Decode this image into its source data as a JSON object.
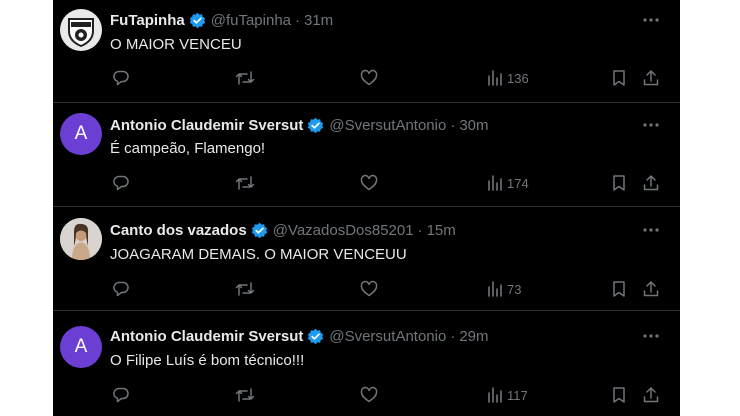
{
  "tweets": [
    {
      "name": "FuTapinha",
      "handle": "@fuTapinha",
      "time": "31m",
      "text": "O MAIOR VENCEU",
      "avatar_type": "logo",
      "views": "136"
    },
    {
      "name": "Antonio Claudemir Sversut",
      "handle": "@SversutAntonio",
      "time": "30m",
      "text": "É campeão, Flamengo!",
      "avatar_type": "letter",
      "avatar_letter": "A",
      "views": "174"
    },
    {
      "name": "Canto dos vazados",
      "handle": "@VazadosDos85201",
      "time": "15m",
      "text": "JOAGARAM DEMAIS. O MAIOR VENCEUU",
      "avatar_type": "photo",
      "views": "73"
    },
    {
      "name": "Antonio Claudemir Sversut",
      "handle": "@SversutAntonio",
      "time": "29m",
      "text": "O Filipe Luís é bom técnico!!!",
      "avatar_type": "letter",
      "avatar_letter": "A",
      "views": "117"
    }
  ],
  "separator": "·",
  "colors": {
    "background": "#000000",
    "text_primary": "#e7e9ea",
    "text_secondary": "#71767b",
    "verified_blue": "#1d9bf0",
    "avatar_purple": "#6b3fd4",
    "divider": "#2f3336"
  },
  "icons": [
    "verified-badge-icon",
    "more-icon",
    "reply-icon",
    "retweet-icon",
    "like-icon",
    "views-icon",
    "bookmark-icon",
    "share-icon"
  ]
}
